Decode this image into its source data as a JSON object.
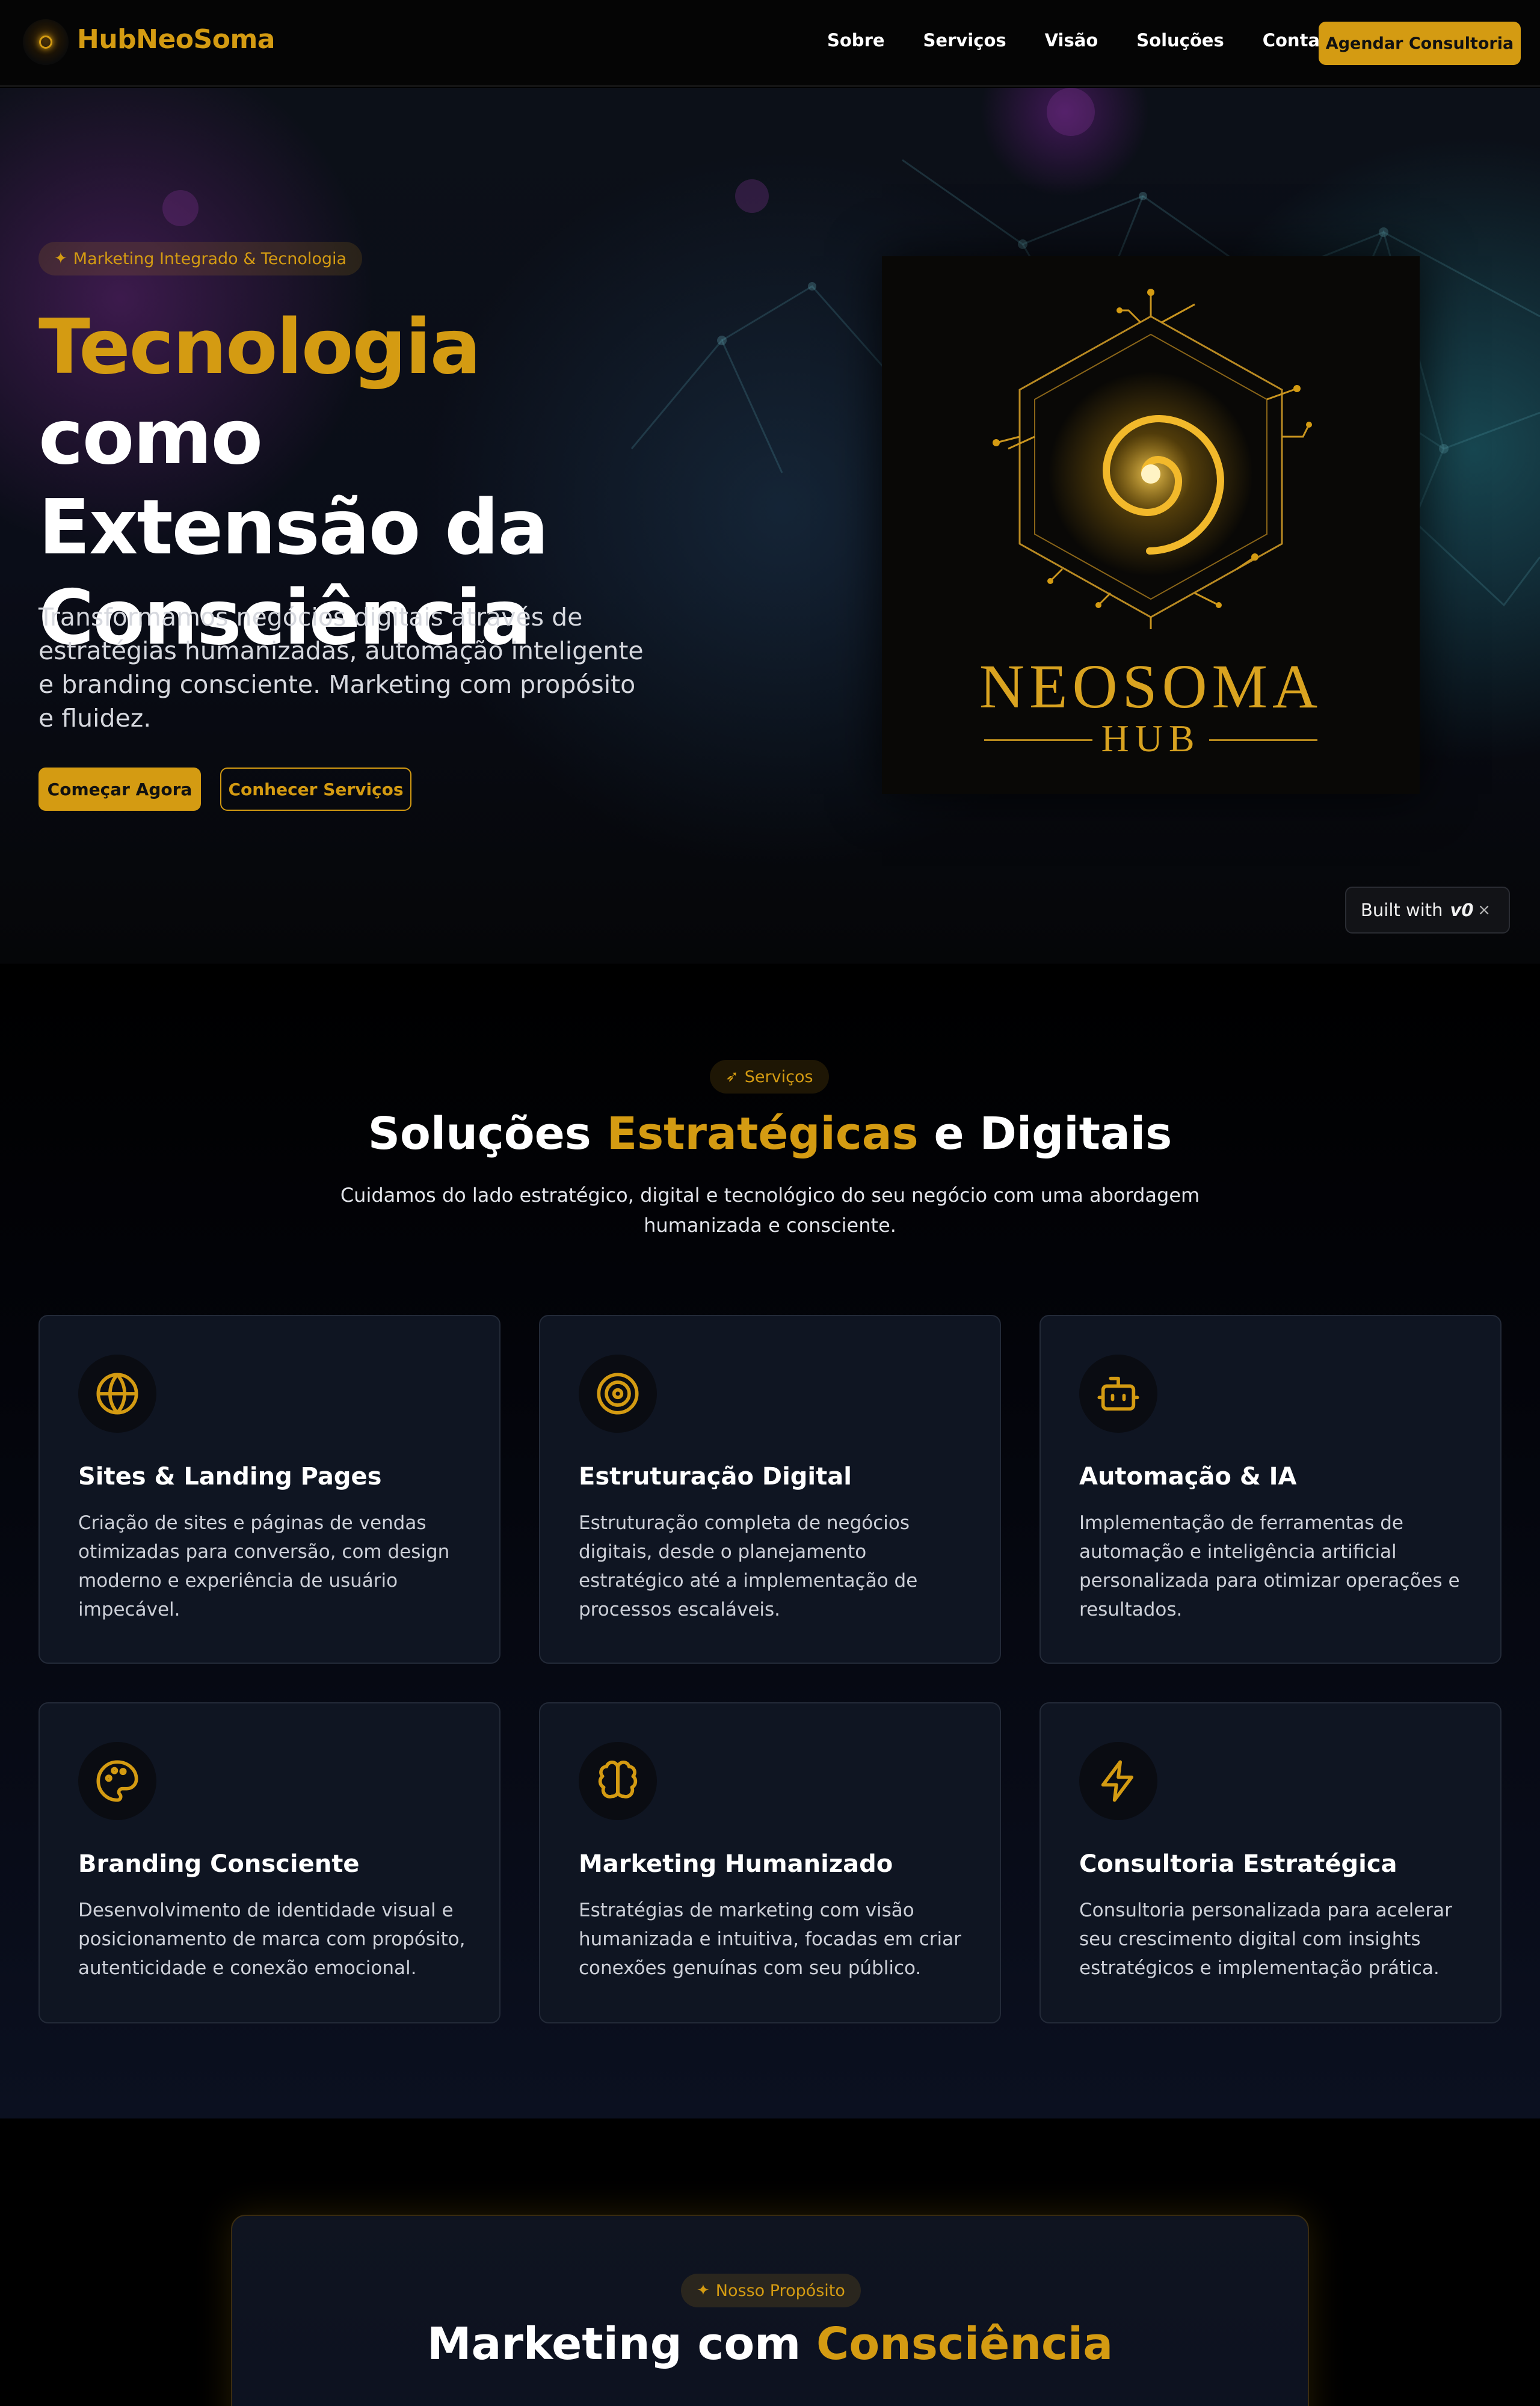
{
  "nav": {
    "brand": "HubNeoSoma",
    "links": [
      "Sobre",
      "Serviços",
      "Visão",
      "Soluções",
      "Contato"
    ],
    "cta": "Agendar Consultoria"
  },
  "hero": {
    "badge": "Marketing Integrado & Tecnologia",
    "title_highlight": "Tecnologia",
    "title_rest_1": " como",
    "title_line_2": "Extensão da",
    "title_line_3": "Consciência",
    "lead": "Transformamos negócios digitais através de estratégias humanizadas, automação inteligente e branding consciente. Marketing com propósito e fluidez.",
    "primary_button": "Começar Agora",
    "secondary_button": "Conhecer Serviços",
    "image_wordmark": "NEOSOMA",
    "image_submark": "HUB"
  },
  "built_with": {
    "label": "Built with",
    "logo": "v0",
    "close": "×"
  },
  "services": {
    "badge": "Serviços",
    "title_a": "Soluções ",
    "title_highlight": "Estratégicas",
    "title_b": " e Digitais",
    "subtitle": "Cuidamos do lado estratégico, digital e tecnológico do seu negócio com uma abordagem humanizada e consciente.",
    "cards": [
      {
        "icon": "globe-icon",
        "title": "Sites & Landing Pages",
        "text": "Criação de sites e páginas de vendas otimizadas para conversão, com design moderno e experiência de usuário impecável."
      },
      {
        "icon": "target-icon",
        "title": "Estruturação Digital",
        "text": "Estruturação completa de negócios digitais, desde o planejamento estratégico até a implementação de processos escaláveis."
      },
      {
        "icon": "bot-icon",
        "title": "Automação & IA",
        "text": "Implementação de ferramentas de automação e inteligência artificial personalizada para otimizar operações e resultados."
      },
      {
        "icon": "palette-icon",
        "title": "Branding Consciente",
        "text": "Desenvolvimento de identidade visual e posicionamento de marca com propósito, autenticidade e conexão emocional."
      },
      {
        "icon": "brain-icon",
        "title": "Marketing Humanizado",
        "text": "Estratégias de marketing com visão humanizada e intuitiva, focadas em criar conexões genuínas com seu público."
      },
      {
        "icon": "zap-icon",
        "title": "Consultoria Estratégica",
        "text": "Consultoria personalizada para acelerar seu crescimento digital com insights estratégicos e implementação prática."
      }
    ]
  },
  "purpose": {
    "badge": "Nosso Propósito",
    "title_a": "Marketing com ",
    "title_highlight": "Consciência"
  },
  "colors": {
    "accent": "#d49b12",
    "background": "#000000",
    "card": "#0f1522"
  }
}
